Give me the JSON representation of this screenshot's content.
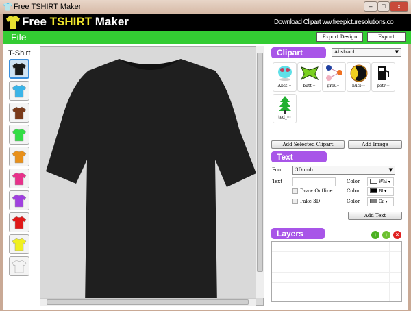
{
  "window": {
    "title": "Free TSHIRT Maker"
  },
  "header": {
    "logo_free": "Free ",
    "logo_tshirt": "TSHIRT",
    "logo_maker": " Maker",
    "download_link": "Download Clipart",
    "site_link": "ww.freepicturesolutions.co"
  },
  "menu": {
    "file": "File",
    "export_design": "Export Design",
    "export": "Export"
  },
  "tshirt": {
    "label": "T-Shirt",
    "colors": [
      "#1a1a1a",
      "#3ab4e8",
      "#7a3a1a",
      "#33dd44",
      "#e8901a",
      "#e8308a",
      "#a040e0",
      "#e01818",
      "#f0f020",
      "#f4f4f4"
    ],
    "selected": 0
  },
  "clipart": {
    "title": "Clipart",
    "category": "Abstract",
    "items": [
      "Abst⋯",
      "butt⋯",
      "grou⋯",
      "nucl⋯",
      "petr⋯",
      "ted_⋯"
    ],
    "add_selected": "Add Selected Clipart",
    "add_image": "Add Image"
  },
  "text": {
    "title": "Text",
    "font_label": "Font",
    "font_value": "3Dumb",
    "text_label": "Text",
    "text_value": "",
    "draw_outline": "Draw Outline",
    "fake_3d": "Fake 3D",
    "color_label": "Color",
    "colors": [
      {
        "name": "Whi",
        "hex": "#ffffff"
      },
      {
        "name": "Bl",
        "hex": "#000000"
      },
      {
        "name": "Gr",
        "hex": "#808080"
      }
    ],
    "add_text": "Add Text"
  },
  "layers": {
    "title": "Layers",
    "up": "↑",
    "down": "↓",
    "delete": "×"
  }
}
